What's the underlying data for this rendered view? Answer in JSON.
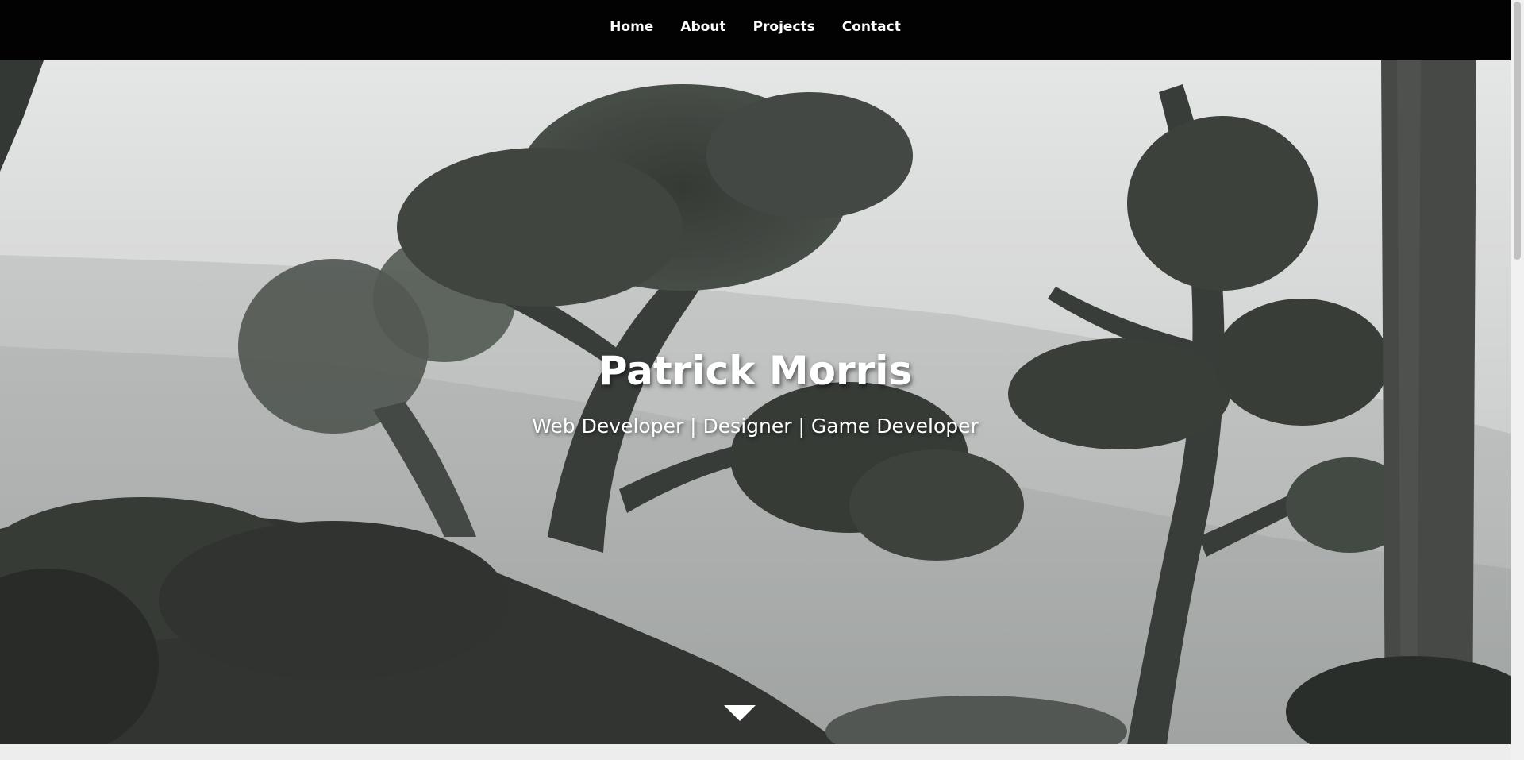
{
  "nav": {
    "items": [
      {
        "label": "Home"
      },
      {
        "label": "About"
      },
      {
        "label": "Projects"
      },
      {
        "label": "Contact"
      }
    ]
  },
  "hero": {
    "title": "Patrick Morris",
    "subtitle": "Web Developer | Designer | Game Developer",
    "background": "misty-forest-trees-image",
    "scroll_icon": "down-triangle-icon"
  },
  "colors": {
    "nav_background": "#020202",
    "text": "#ffffff"
  }
}
